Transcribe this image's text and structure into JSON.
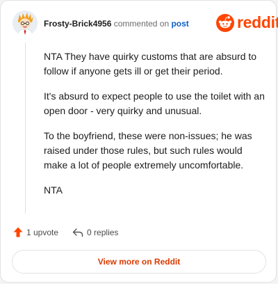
{
  "comment": {
    "username": "Frosty-Brick4956",
    "action_text": "commented on",
    "post_link": "post",
    "paragraphs": [
      "NTA They have quirky customs that are absurd to follow if anyone gets ill or get their period.",
      "It's absurd to expect people to use the toilet with an open door - very quirky and unusual.",
      "To the boyfriend, these were non-issues; he was raised under those rules, but such rules would make a lot of people extremely uncomfortable.",
      "NTA"
    ]
  },
  "brand": {
    "name": "reddit",
    "color": "#ff4500",
    "icon": "reddit-snoo-icon"
  },
  "footer": {
    "upvotes": "1 upvote",
    "replies": "0 replies",
    "upvote_icon": "upvote-arrow-icon",
    "reply_icon": "reply-arrow-icon",
    "upvote_color": "#ff4500"
  },
  "view_more": {
    "label": "View more on Reddit"
  }
}
